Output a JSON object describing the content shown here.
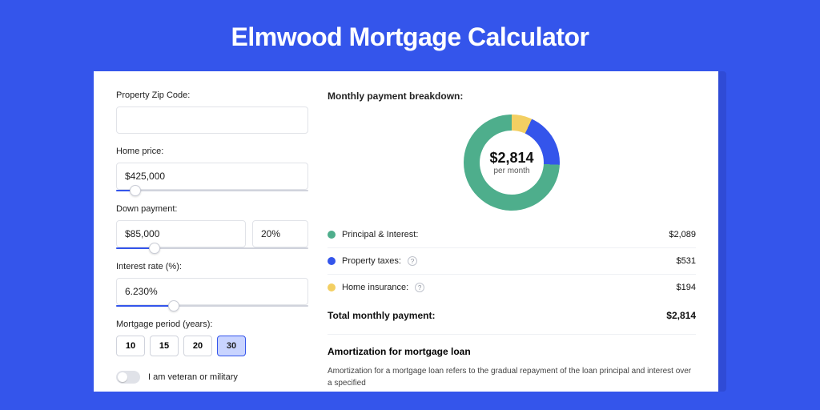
{
  "title": "Elmwood Mortgage Calculator",
  "form": {
    "zip_label": "Property Zip Code:",
    "zip_value": "",
    "home_price_label": "Home price:",
    "home_price_value": "$425,000",
    "home_price_slider_pct": 10,
    "down_payment_label": "Down payment:",
    "down_payment_value": "$85,000",
    "down_payment_pct": "20%",
    "down_payment_slider_pct": 20,
    "interest_label": "Interest rate (%):",
    "interest_value": "6.230%",
    "interest_slider_pct": 30,
    "period_label": "Mortgage period (years):",
    "period_options": [
      "10",
      "15",
      "20",
      "30"
    ],
    "period_selected": "30",
    "veteran_label": "I am veteran or military"
  },
  "breakdown": {
    "title": "Monthly payment breakdown:",
    "center_value": "$2,814",
    "center_sub": "per month",
    "items": [
      {
        "label": "Principal & Interest:",
        "value": "$2,089",
        "color": "#4eae8c",
        "info": false
      },
      {
        "label": "Property taxes:",
        "value": "$531",
        "color": "#3455eb",
        "info": true
      },
      {
        "label": "Home insurance:",
        "value": "$194",
        "color": "#f3cf62",
        "info": true
      }
    ],
    "total_label": "Total monthly payment:",
    "total_value": "$2,814"
  },
  "chart_data": {
    "type": "pie",
    "title": "Monthly payment breakdown",
    "series": [
      {
        "name": "Principal & Interest",
        "value": 2089,
        "color": "#4eae8c"
      },
      {
        "name": "Property taxes",
        "value": 531,
        "color": "#3455eb"
      },
      {
        "name": "Home insurance",
        "value": 194,
        "color": "#f3cf62"
      }
    ],
    "total": 2814,
    "center_label": "$2,814 per month"
  },
  "amort": {
    "title": "Amortization for mortgage loan",
    "text": "Amortization for a mortgage loan refers to the gradual repayment of the loan principal and interest over a specified"
  }
}
